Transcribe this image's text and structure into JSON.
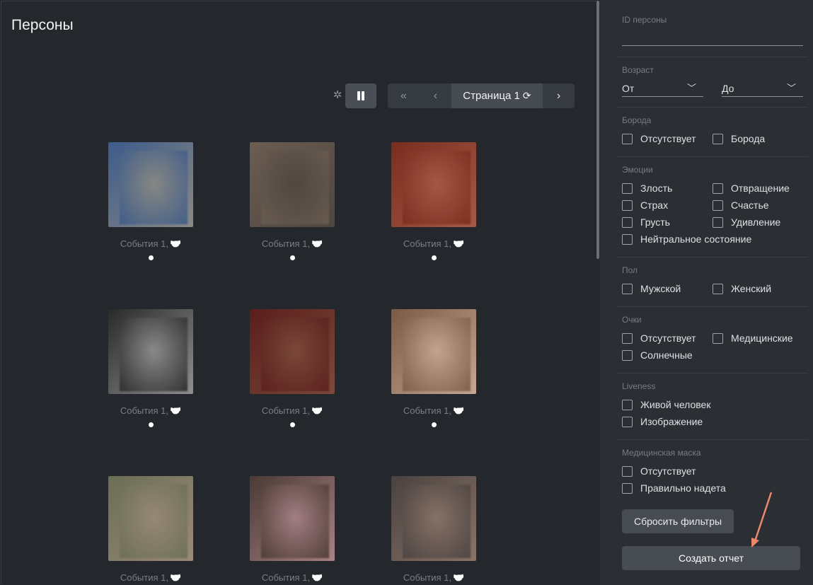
{
  "page": {
    "title": "Персоны"
  },
  "toolbar": {
    "loader_icon": "spinner-icon",
    "pause_icon": "pause-icon",
    "pager": {
      "first": "«",
      "prev": "‹",
      "current": "Страница 1",
      "refresh_icon": "⟳",
      "next": "›"
    }
  },
  "persons": [
    {
      "caption": "События 1,",
      "icon": "handshake-icon",
      "colors": [
        "#3d5b8a",
        "#8a8a84"
      ]
    },
    {
      "caption": "События 1,",
      "icon": "handshake-icon",
      "colors": [
        "#6b5d52",
        "#4e4640"
      ]
    },
    {
      "caption": "События 1,",
      "icon": "handshake-icon",
      "colors": [
        "#7a2c1e",
        "#a85a48"
      ]
    },
    {
      "caption": "События 1,",
      "icon": "handshake-icon",
      "colors": [
        "#2a2a2a",
        "#8f8f8f"
      ]
    },
    {
      "caption": "События 1,",
      "icon": "handshake-icon",
      "colors": [
        "#5a1e1c",
        "#7c4a3a"
      ]
    },
    {
      "caption": "События 1,",
      "icon": "handshake-icon",
      "colors": [
        "#7a5a45",
        "#c8a894"
      ]
    },
    {
      "caption": "События 1,",
      "icon": "handshake-icon",
      "colors": [
        "#6a6e54",
        "#9a8a78"
      ]
    },
    {
      "caption": "События 1,",
      "icon": "handshake-icon",
      "colors": [
        "#4a3a34",
        "#a88286"
      ]
    },
    {
      "caption": "События 1,",
      "icon": "handshake-icon",
      "colors": [
        "#4a4240",
        "#8a7468"
      ]
    }
  ],
  "filters": {
    "person_id": {
      "label": "ID персоны",
      "value": ""
    },
    "age": {
      "label": "Возраст",
      "from": "От",
      "to": "До"
    },
    "beard": {
      "label": "Борода",
      "options": [
        "Отсутствует",
        "Борода"
      ]
    },
    "emotions": {
      "label": "Эмоции",
      "options": [
        "Злость",
        "Отвращение",
        "Страх",
        "Счастье",
        "Грусть",
        "Удивление",
        "Нейтральное состояние"
      ]
    },
    "gender": {
      "label": "Пол",
      "options": [
        "Мужской",
        "Женский"
      ]
    },
    "glasses": {
      "label": "Очки",
      "options": [
        "Отсутствует",
        "Медицинские",
        "Солнечные"
      ]
    },
    "liveness": {
      "label": "Liveness",
      "options": [
        "Живой человек",
        "Изображение"
      ]
    },
    "mask": {
      "label": "Медицинская маска",
      "options": [
        "Отсутствует",
        "Правильно надета"
      ]
    }
  },
  "actions": {
    "reset": "Сбросить фильтры",
    "report": "Создать отчет"
  },
  "annotation_color": "#f0876a"
}
